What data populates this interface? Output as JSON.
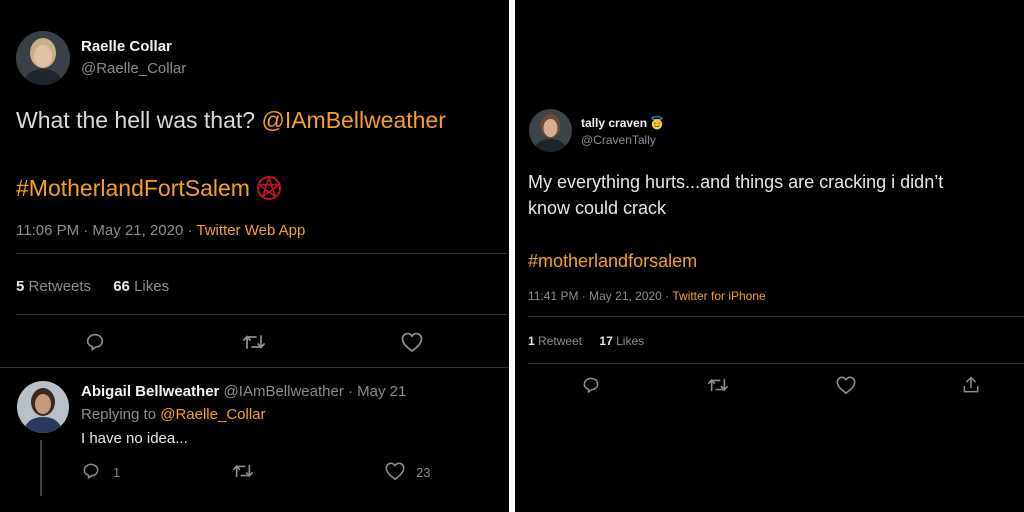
{
  "left_tweet": {
    "author_name": "Raelle Collar",
    "author_handle": "@Raelle_Collar",
    "text_prefix": "What the hell was that? ",
    "mention": "@IAmBellweather",
    "hashtag": "#MotherlandFortSalem",
    "hashtag_emoji": "pentagram-emoji",
    "timestamp": "11:06 PM · May 21, 2020 · ",
    "source": "Twitter Web App",
    "retweets_count": "5",
    "retweets_label": "Retweets",
    "likes_count": "66",
    "likes_label": "Likes",
    "actions": [
      "reply-icon",
      "retweet-icon",
      "like-icon"
    ]
  },
  "reply": {
    "author_name": "Abigail Bellweather",
    "author_handle_date": "@IAmBellweather · May 21",
    "replying_to_label": "Replying to ",
    "replying_to_handle": "@Raelle_Collar",
    "text": "I have no idea...",
    "reply_count": "1",
    "like_count": "23"
  },
  "right_tweet": {
    "author_name": "tally craven",
    "author_emoji": "smiling-face-with-halo-emoji",
    "author_handle": "@CravenTally",
    "text_line1": "My everything hurts...and things are cracking i didn’t",
    "text_line2": "know could crack",
    "hashtag": "#motherlandforsalem",
    "timestamp": "11:41 PM · May 21, 2020 · ",
    "source": "Twitter for iPhone",
    "retweets_count": "1",
    "retweets_label": "Retweet",
    "likes_count": "17",
    "likes_label": "Likes",
    "actions": [
      "reply-icon",
      "retweet-icon",
      "like-icon",
      "share-icon"
    ]
  },
  "colors": {
    "background": "#000000",
    "accent": "#f5a025",
    "text": "#d9d9d9",
    "muted": "#8a8d91",
    "divider": "#2f3336",
    "separator": "#ffffff"
  }
}
